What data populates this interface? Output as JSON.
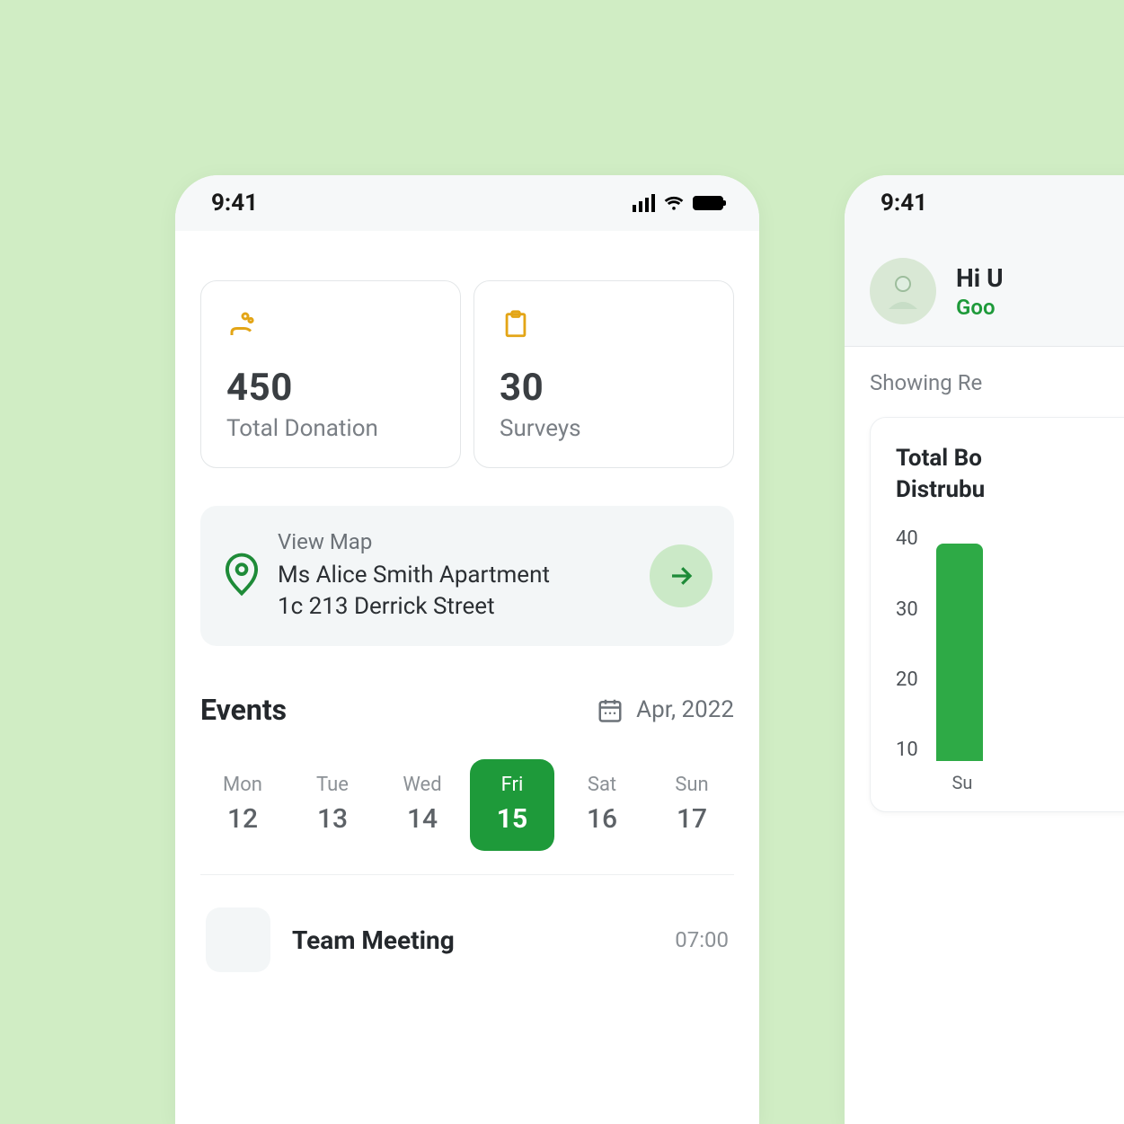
{
  "status": {
    "time": "9:41"
  },
  "metrics": [
    {
      "value": "450",
      "label": "Total Donation"
    },
    {
      "value": "30",
      "label": "Surveys"
    }
  ],
  "map": {
    "title": "View Map",
    "line1": "Ms Alice Smith Apartment",
    "line2": "1c 213 Derrick Street"
  },
  "events": {
    "heading": "Events",
    "month": "Apr, 2022",
    "days": [
      {
        "dow": "Mon",
        "num": "12",
        "selected": false
      },
      {
        "dow": "Tue",
        "num": "13",
        "selected": false
      },
      {
        "dow": "Wed",
        "num": "14",
        "selected": false
      },
      {
        "dow": "Fri",
        "num": "15",
        "selected": true
      },
      {
        "dow": "Sat",
        "num": "16",
        "selected": false
      },
      {
        "dow": "Sun",
        "num": "17",
        "selected": false
      }
    ],
    "items": [
      {
        "title": "Team Meeting",
        "time": "07:00"
      }
    ]
  },
  "phone2": {
    "greeting_name": "Hi U",
    "greeting_sub": "Goo",
    "showing": "Showing Re",
    "chart_title_l1": "Total Bo",
    "chart_title_l2": "Distrubu"
  },
  "chart_data": {
    "type": "bar",
    "title": "Total Bo… Distrubu…",
    "xlabel": "",
    "ylabel": "",
    "yticks": [
      40,
      30,
      20,
      10
    ],
    "ylim": [
      0,
      45
    ],
    "categories": [
      "Su"
    ],
    "values": [
      42
    ]
  }
}
